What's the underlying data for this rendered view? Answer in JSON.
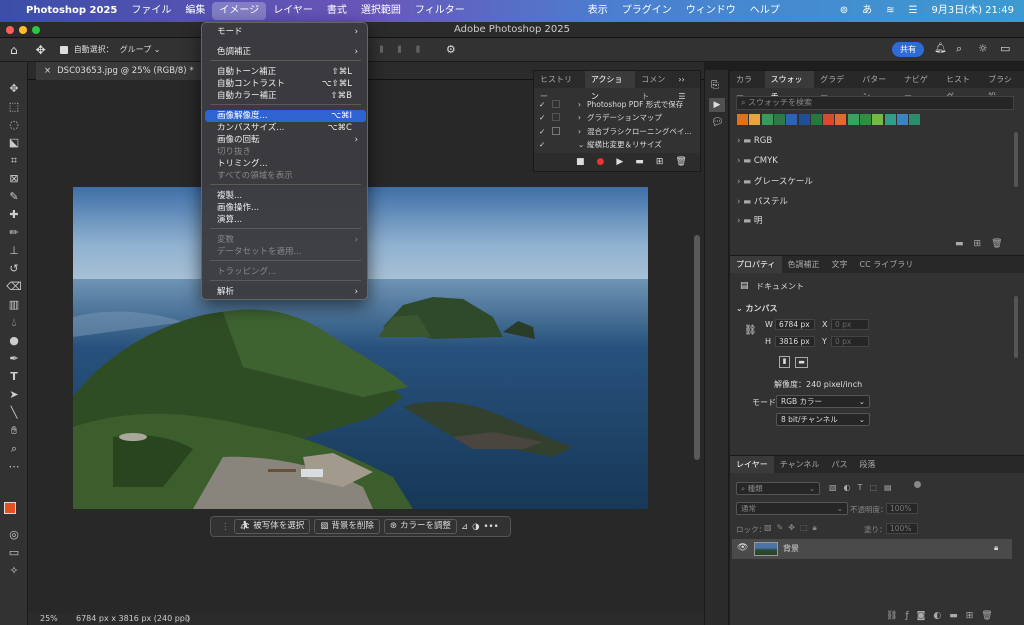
{
  "menubar": {
    "apple": "",
    "app": "Photoshop 2025",
    "items": [
      "ファイル",
      "編集",
      "イメージ",
      "レイヤー",
      "書式",
      "選択範囲",
      "フィルター"
    ],
    "right": [
      "表示",
      "プラグイン",
      "ウィンドウ",
      "ヘルプ"
    ],
    "ime": "あ",
    "clock": "9月3日(木) 21:49"
  },
  "window": {
    "title": "Adobe Photoshop 2025"
  },
  "options_bar": {
    "auto_select_label": "自動選択：",
    "group_value": "グループ",
    "share_label": "共有"
  },
  "document": {
    "tab": "DSC03653.jpg @ 25% (RGB/8) *"
  },
  "image_menu": {
    "items": [
      {
        "label": "モード",
        "shortcut": "",
        "sub": true,
        "disabled": false
      },
      {
        "label": "色調補正",
        "shortcut": "",
        "sub": true,
        "disabled": false
      },
      {
        "label": "自動トーン補正",
        "shortcut": "⇧⌘L",
        "sub": false,
        "disabled": false
      },
      {
        "label": "自動コントラスト",
        "shortcut": "⌥⇧⌘L",
        "sub": false,
        "disabled": false
      },
      {
        "label": "自動カラー補正",
        "shortcut": "⇧⌘B",
        "sub": false,
        "disabled": false
      },
      {
        "label": "画像解像度...",
        "shortcut": "⌥⌘I",
        "sub": false,
        "disabled": false,
        "highlight": true
      },
      {
        "label": "カンバスサイズ...",
        "shortcut": "⌥⌘C",
        "sub": false,
        "disabled": false
      },
      {
        "label": "画像の回転",
        "shortcut": "",
        "sub": true,
        "disabled": false
      },
      {
        "label": "切り抜き",
        "shortcut": "",
        "sub": false,
        "disabled": true
      },
      {
        "label": "トリミング...",
        "shortcut": "",
        "sub": false,
        "disabled": false
      },
      {
        "label": "すべての領域を表示",
        "shortcut": "",
        "sub": false,
        "disabled": true
      },
      {
        "label": "複製...",
        "shortcut": "",
        "sub": false,
        "disabled": false
      },
      {
        "label": "画像操作...",
        "shortcut": "",
        "sub": false,
        "disabled": false
      },
      {
        "label": "演算...",
        "shortcut": "",
        "sub": false,
        "disabled": false
      },
      {
        "label": "変数",
        "shortcut": "",
        "sub": true,
        "disabled": true
      },
      {
        "label": "データセットを適用...",
        "shortcut": "",
        "sub": false,
        "disabled": true
      },
      {
        "label": "トラッピング...",
        "shortcut": "",
        "sub": false,
        "disabled": true
      },
      {
        "label": "解析",
        "shortcut": "",
        "sub": true,
        "disabled": false
      }
    ]
  },
  "actions_panel": {
    "tabs": [
      "ヒストリー",
      "アクション",
      "コメント"
    ],
    "rows": [
      "Photoshop PDF 形式で保存",
      "グラデーションマップ",
      "混合ブラシクローニングペイ...",
      "縦横比変更＆リサイズ"
    ]
  },
  "context_bar": {
    "select_subject": "被写体を選択",
    "remove_bg": "背景を削除",
    "adjust_color": "カラーを調整"
  },
  "status": {
    "zoom": "25%",
    "info": "6784 px x 3816 px (240 ppi)"
  },
  "swatches_panel": {
    "tabs": [
      "カラー",
      "スウォッチ",
      "グラデー",
      "パターン",
      "ナビゲー",
      "ヒストグ",
      "ブラシ設"
    ],
    "search_placeholder": "スウォッチを検索",
    "colors": [
      "#e1721d",
      "#e8a53a",
      "#3a9a5b",
      "#2c7a48",
      "#2a63b8",
      "#1e4f9a",
      "#26783c",
      "#d84a2c",
      "#e26a2a",
      "#37a35d",
      "#2f8e3f",
      "#74b944",
      "#2ea08a",
      "#3a84c4",
      "#2a8e6e"
    ],
    "groups": [
      "RGB",
      "CMYK",
      "グレースケール",
      "パステル",
      "明"
    ]
  },
  "properties_panel": {
    "tabs": [
      "プロパティ",
      "色調補正",
      "文字",
      "CC ライブラリ"
    ],
    "doc_label": "ドキュメント",
    "canvas_label": "カンバス",
    "w_label": "W",
    "w_value": "6784 px",
    "h_label": "H",
    "h_value": "3816 px",
    "x_label": "X",
    "x_placeholder": "0 px",
    "y_label": "Y",
    "y_placeholder": "0 px",
    "resolution": "解像度：240 pixel/inch",
    "mode_label": "モード",
    "mode_value": "RGB カラー",
    "depth_value": "8 bit/チャンネル"
  },
  "layers_panel": {
    "tabs": [
      "レイヤー",
      "チャンネル",
      "パス",
      "段落"
    ],
    "filter_label": "種類",
    "blend_mode": "通常",
    "opacity_label": "不透明度：",
    "opacity_value": "100%",
    "lock_label": "ロック：",
    "fill_label": "塗り：",
    "fill_value": "100%",
    "layer_name": "背景"
  }
}
